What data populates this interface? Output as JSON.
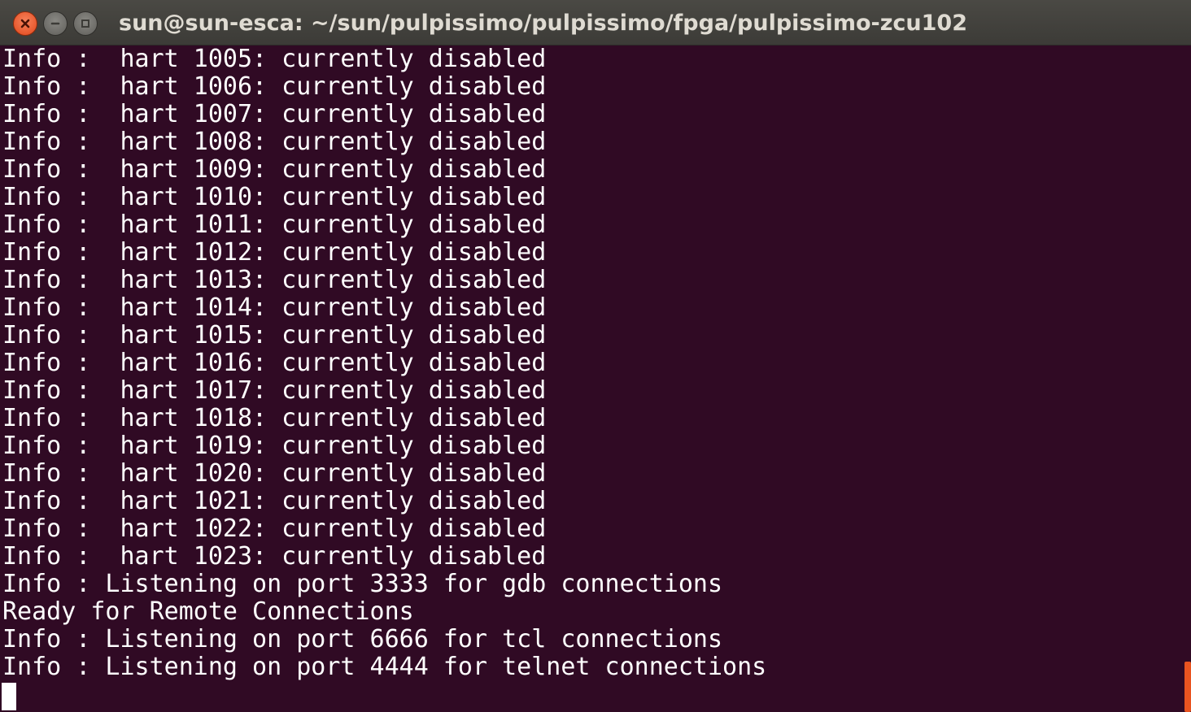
{
  "window": {
    "title": "sun@sun-esca: ~/sun/pulpissimo/pulpissimo/fpga/pulpissimo-zcu102",
    "accent_color": "#e95420",
    "background_color": "#300a24",
    "text_color": "#ffffff"
  },
  "titlebar_buttons": {
    "close_icon": "close-icon",
    "minimize_icon": "minimize-icon",
    "maximize_icon": "maximize-icon"
  },
  "terminal": {
    "lines": [
      "Info :  hart 1005: currently disabled",
      "Info :  hart 1006: currently disabled",
      "Info :  hart 1007: currently disabled",
      "Info :  hart 1008: currently disabled",
      "Info :  hart 1009: currently disabled",
      "Info :  hart 1010: currently disabled",
      "Info :  hart 1011: currently disabled",
      "Info :  hart 1012: currently disabled",
      "Info :  hart 1013: currently disabled",
      "Info :  hart 1014: currently disabled",
      "Info :  hart 1015: currently disabled",
      "Info :  hart 1016: currently disabled",
      "Info :  hart 1017: currently disabled",
      "Info :  hart 1018: currently disabled",
      "Info :  hart 1019: currently disabled",
      "Info :  hart 1020: currently disabled",
      "Info :  hart 1021: currently disabled",
      "Info :  hart 1022: currently disabled",
      "Info :  hart 1023: currently disabled",
      "Info : Listening on port 3333 for gdb connections",
      "Ready for Remote Connections",
      "Info : Listening on port 6666 for tcl connections",
      "Info : Listening on port 4444 for telnet connections"
    ]
  }
}
